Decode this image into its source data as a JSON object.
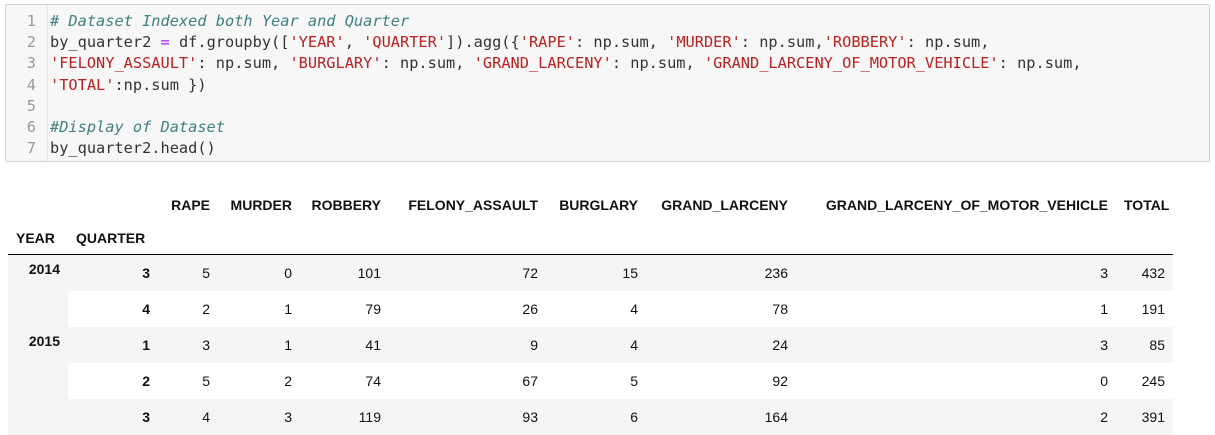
{
  "code_cell": {
    "lines": [
      {
        "n": "1",
        "parts": [
          {
            "t": "# Dataset Indexed both Year and Quarter",
            "c": "cm"
          }
        ]
      },
      {
        "n": "2",
        "parts": [
          {
            "t": "by_quarter2 ",
            "c": ""
          },
          {
            "t": "=",
            "c": "op"
          },
          {
            "t": " df.groupby([",
            "c": ""
          },
          {
            "t": "'YEAR'",
            "c": "st"
          },
          {
            "t": ", ",
            "c": ""
          },
          {
            "t": "'QUARTER'",
            "c": "st"
          },
          {
            "t": "]).agg({",
            "c": ""
          },
          {
            "t": "'RAPE'",
            "c": "st"
          },
          {
            "t": ": np.sum, ",
            "c": ""
          },
          {
            "t": "'MURDER'",
            "c": "st"
          },
          {
            "t": ": np.sum,",
            "c": ""
          },
          {
            "t": "'ROBBERY'",
            "c": "st"
          },
          {
            "t": ": np.sum,",
            "c": ""
          }
        ]
      },
      {
        "n": "3",
        "parts": [
          {
            "t": "'FELONY_ASSAULT'",
            "c": "st"
          },
          {
            "t": ": np.sum, ",
            "c": ""
          },
          {
            "t": "'BURGLARY'",
            "c": "st"
          },
          {
            "t": ": np.sum, ",
            "c": ""
          },
          {
            "t": "'GRAND_LARCENY'",
            "c": "st"
          },
          {
            "t": ": np.sum, ",
            "c": ""
          },
          {
            "t": "'GRAND_LARCENY_OF_MOTOR_VEHICLE'",
            "c": "st"
          },
          {
            "t": ": np.sum,",
            "c": ""
          }
        ]
      },
      {
        "n": "4",
        "parts": [
          {
            "t": "'TOTAL'",
            "c": "st"
          },
          {
            "t": ":np.sum })",
            "c": ""
          }
        ]
      },
      {
        "n": "5",
        "parts": []
      },
      {
        "n": "6",
        "parts": [
          {
            "t": "#Display of Dataset",
            "c": "cm"
          }
        ]
      },
      {
        "n": "7",
        "parts": [
          {
            "t": "by_quarter2.head()",
            "c": ""
          }
        ]
      }
    ]
  },
  "dataframe": {
    "columns": [
      "RAPE",
      "MURDER",
      "ROBBERY",
      "FELONY_ASSAULT",
      "BURGLARY",
      "GRAND_LARCENY",
      "GRAND_LARCENY_OF_MOTOR_VEHICLE",
      "TOTAL"
    ],
    "index_names": [
      "YEAR",
      "QUARTER"
    ],
    "rows": [
      {
        "year": "2014",
        "quarter": "3",
        "values": [
          "5",
          "0",
          "101",
          "72",
          "15",
          "236",
          "3",
          "432"
        ]
      },
      {
        "year": "",
        "quarter": "4",
        "values": [
          "2",
          "1",
          "79",
          "26",
          "4",
          "78",
          "1",
          "191"
        ]
      },
      {
        "year": "2015",
        "quarter": "1",
        "values": [
          "3",
          "1",
          "41",
          "9",
          "4",
          "24",
          "3",
          "85"
        ]
      },
      {
        "year": "",
        "quarter": "2",
        "values": [
          "5",
          "2",
          "74",
          "67",
          "5",
          "92",
          "0",
          "245"
        ]
      },
      {
        "year": "",
        "quarter": "3",
        "values": [
          "4",
          "3",
          "119",
          "93",
          "6",
          "164",
          "2",
          "391"
        ]
      }
    ]
  }
}
